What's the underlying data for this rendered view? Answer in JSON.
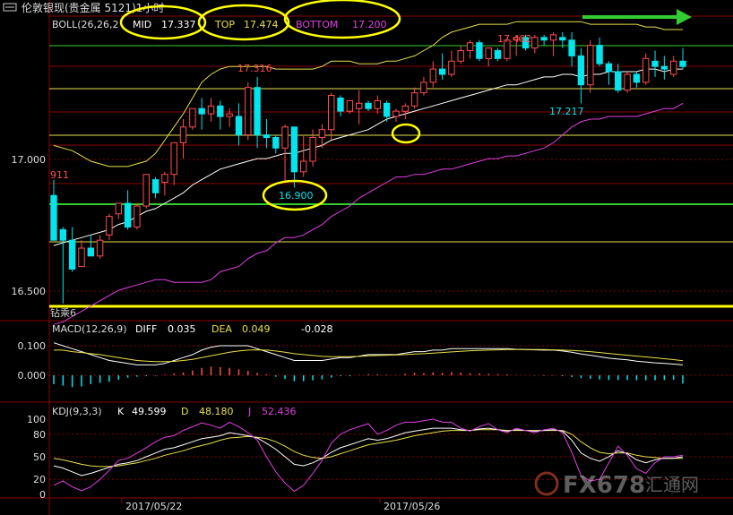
{
  "window": {
    "title": "伦敦银现(贵金属 5121)1小时"
  },
  "colors": {
    "background": "#000000",
    "up_candle": "#ff4d4d",
    "down_candle": "#00e5ee",
    "boll_mid": "#ffffff",
    "boll_top": "#e8e04a",
    "boll_bottom": "#e040e0",
    "macd_diff": "#ffffff",
    "macd_dea": "#e8e04a",
    "kdj_k": "#ffffff",
    "kdj_d": "#e8e04a",
    "kdj_j": "#e040e0",
    "highlight": "#ffff00",
    "grid_red": "#8b0000",
    "line_green": "#33cc33",
    "line_yellow": "#e8e04a"
  },
  "chart_data": [
    {
      "type": "candlestick",
      "indicator": {
        "name": "BOLL(26,26,2)",
        "label_text": "BOLL(26,26,2",
        "mid_label": "MID",
        "mid_value": "17.337",
        "top_label": "TOP",
        "top_value": "17.474",
        "bottom_label": "BOTTOM",
        "bottom_value": "17.200"
      },
      "y_ticks": [
        "17.000",
        "16.500"
      ],
      "ylim": [
        16.42,
        17.62
      ],
      "x_ticks": [
        "2017/05/22",
        "2017/05/26"
      ],
      "annotations": [
        {
          "text": "17.316",
          "kind": "high"
        },
        {
          "text": "911",
          "kind": "high"
        },
        {
          "text": "17.482",
          "kind": "high"
        },
        {
          "text": "16.900",
          "kind": "low"
        },
        {
          "text": "17.217",
          "kind": "low"
        }
      ],
      "watermark_left": "钻乘6",
      "candles": [
        [
          16.87,
          16.93,
          16.7,
          16.7
        ],
        [
          16.74,
          16.75,
          16.46,
          16.7
        ],
        [
          16.7,
          16.75,
          16.58,
          16.59
        ],
        [
          16.6,
          16.7,
          16.6,
          16.67
        ],
        [
          16.67,
          16.72,
          16.64,
          16.64
        ],
        [
          16.64,
          16.72,
          16.63,
          16.7
        ],
        [
          16.72,
          16.8,
          16.7,
          16.79
        ],
        [
          16.8,
          16.84,
          16.78,
          16.84
        ],
        [
          16.84,
          16.89,
          16.74,
          16.75
        ],
        [
          16.75,
          16.84,
          16.74,
          16.83
        ],
        [
          16.83,
          16.95,
          16.82,
          16.95
        ],
        [
          16.93,
          16.94,
          16.86,
          16.88
        ],
        [
          16.92,
          16.96,
          16.87,
          16.95
        ],
        [
          16.95,
          17.07,
          16.91,
          17.07
        ],
        [
          17.07,
          17.16,
          17.01,
          17.13
        ],
        [
          17.13,
          17.2,
          17.12,
          17.2
        ],
        [
          17.2,
          17.24,
          17.12,
          17.18
        ],
        [
          17.18,
          17.24,
          17.15,
          17.21
        ],
        [
          17.21,
          17.23,
          17.12,
          17.17
        ],
        [
          17.17,
          17.2,
          17.13,
          17.18
        ],
        [
          17.17,
          17.22,
          17.06,
          17.1
        ],
        [
          17.1,
          17.3,
          17.08,
          17.28
        ],
        [
          17.28,
          17.32,
          17.05,
          17.1
        ],
        [
          17.1,
          17.16,
          17.05,
          17.09
        ],
        [
          17.09,
          17.1,
          17.03,
          17.05
        ],
        [
          17.05,
          17.14,
          16.92,
          17.13
        ],
        [
          17.13,
          17.13,
          16.9,
          16.96
        ],
        [
          16.96,
          17.1,
          16.94,
          17.0
        ],
        [
          17.0,
          17.12,
          16.98,
          17.09
        ],
        [
          17.09,
          17.14,
          17.05,
          17.12
        ],
        [
          17.12,
          17.26,
          17.08,
          17.25
        ],
        [
          17.24,
          17.25,
          17.17,
          17.19
        ],
        [
          17.19,
          17.23,
          17.18,
          17.23
        ],
        [
          17.2,
          17.27,
          17.14,
          17.22
        ],
        [
          17.22,
          17.23,
          17.19,
          17.2
        ],
        [
          17.2,
          17.25,
          17.18,
          17.23
        ],
        [
          17.22,
          17.23,
          17.15,
          17.17
        ],
        [
          17.17,
          17.2,
          17.15,
          17.19
        ],
        [
          17.19,
          17.22,
          17.16,
          17.21
        ],
        [
          17.21,
          17.28,
          17.2,
          17.26
        ],
        [
          17.26,
          17.32,
          17.25,
          17.3
        ],
        [
          17.3,
          17.38,
          17.28,
          17.35
        ],
        [
          17.35,
          17.41,
          17.31,
          17.33
        ],
        [
          17.33,
          17.42,
          17.32,
          17.38
        ],
        [
          17.38,
          17.44,
          17.37,
          17.42
        ],
        [
          17.42,
          17.46,
          17.39,
          17.45
        ],
        [
          17.45,
          17.46,
          17.38,
          17.39
        ],
        [
          17.39,
          17.43,
          17.36,
          17.43
        ],
        [
          17.42,
          17.43,
          17.38,
          17.39
        ],
        [
          17.39,
          17.47,
          17.38,
          17.46
        ],
        [
          17.46,
          17.48,
          17.4,
          17.47
        ],
        [
          17.47,
          17.48,
          17.42,
          17.43
        ],
        [
          17.43,
          17.48,
          17.41,
          17.47
        ],
        [
          17.47,
          17.48,
          17.44,
          17.46
        ],
        [
          17.46,
          17.49,
          17.4,
          17.48
        ],
        [
          17.47,
          17.49,
          17.43,
          17.46
        ],
        [
          17.46,
          17.49,
          17.36,
          17.4
        ],
        [
          17.4,
          17.43,
          17.22,
          17.29
        ],
        [
          17.29,
          17.46,
          17.26,
          17.44
        ],
        [
          17.44,
          17.47,
          17.36,
          17.37
        ],
        [
          17.37,
          17.38,
          17.29,
          17.34
        ],
        [
          17.34,
          17.37,
          17.26,
          17.27
        ],
        [
          17.27,
          17.34,
          17.26,
          17.33
        ],
        [
          17.33,
          17.34,
          17.28,
          17.3
        ],
        [
          17.3,
          17.41,
          17.29,
          17.39
        ],
        [
          17.38,
          17.42,
          17.32,
          17.36
        ],
        [
          17.36,
          17.4,
          17.31,
          17.35
        ],
        [
          17.33,
          17.4,
          17.32,
          17.38
        ],
        [
          17.38,
          17.43,
          17.35,
          17.36
        ]
      ],
      "boll_mid": [
        16.68,
        16.69,
        16.7,
        16.71,
        16.72,
        16.73,
        16.74,
        16.76,
        16.77,
        16.79,
        16.81,
        16.82,
        16.84,
        16.86,
        16.88,
        16.91,
        16.93,
        16.95,
        16.97,
        16.98,
        16.99,
        17.0,
        17.01,
        17.01,
        17.02,
        17.03,
        17.03,
        17.04,
        17.05,
        17.06,
        17.08,
        17.09,
        17.1,
        17.11,
        17.12,
        17.14,
        17.16,
        17.17,
        17.18,
        17.19,
        17.2,
        17.21,
        17.22,
        17.23,
        17.24,
        17.25,
        17.26,
        17.27,
        17.28,
        17.29,
        17.29,
        17.3,
        17.31,
        17.32,
        17.32,
        17.33,
        17.33,
        17.32,
        17.33,
        17.33,
        17.34,
        17.34,
        17.34,
        17.34,
        17.35,
        17.35,
        17.34,
        17.35,
        17.35
      ],
      "boll_top": [
        17.06,
        17.05,
        17.04,
        17.02,
        17.0,
        16.99,
        16.98,
        16.98,
        16.98,
        16.99,
        17.0,
        17.03,
        17.08,
        17.13,
        17.18,
        17.24,
        17.3,
        17.33,
        17.35,
        17.36,
        17.36,
        17.36,
        17.36,
        17.36,
        17.35,
        17.35,
        17.35,
        17.35,
        17.35,
        17.36,
        17.38,
        17.38,
        17.38,
        17.37,
        17.37,
        17.37,
        17.38,
        17.38,
        17.39,
        17.4,
        17.42,
        17.44,
        17.47,
        17.49,
        17.5,
        17.51,
        17.52,
        17.52,
        17.52,
        17.52,
        17.53,
        17.53,
        17.53,
        17.53,
        17.53,
        17.53,
        17.53,
        17.53,
        17.52,
        17.52,
        17.52,
        17.52,
        17.52,
        17.52,
        17.51,
        17.51,
        17.5,
        17.5,
        17.5
      ],
      "boll_bottom": [
        16.38,
        16.39,
        16.41,
        16.43,
        16.45,
        16.47,
        16.49,
        16.51,
        16.52,
        16.53,
        16.54,
        16.55,
        16.55,
        16.54,
        16.54,
        16.54,
        16.54,
        16.55,
        16.58,
        16.59,
        16.6,
        16.63,
        16.65,
        16.66,
        16.69,
        16.71,
        16.71,
        16.72,
        16.74,
        16.76,
        16.79,
        16.81,
        16.83,
        16.86,
        16.88,
        16.9,
        16.92,
        16.94,
        16.94,
        16.95,
        16.95,
        16.96,
        16.97,
        16.97,
        16.98,
        16.99,
        17.0,
        17.01,
        17.01,
        17.02,
        17.02,
        17.03,
        17.04,
        17.05,
        17.07,
        17.1,
        17.13,
        17.15,
        17.16,
        17.16,
        17.17,
        17.17,
        17.17,
        17.17,
        17.18,
        17.19,
        17.2,
        17.2,
        17.22
      ]
    },
    {
      "type": "macd",
      "indicator": {
        "name": "MACD(12,26,9)",
        "diff_label": "DIFF",
        "diff_value": "0.035",
        "dea_label": "DEA",
        "dea_value": "0.049",
        "macd_value": "-0.028"
      },
      "y_ticks": [
        "0.100",
        "0.000"
      ],
      "ylim": [
        -0.09,
        0.12
      ],
      "diff": [
        0.11,
        0.1,
        0.09,
        0.08,
        0.07,
        0.06,
        0.05,
        0.045,
        0.04,
        0.035,
        0.035,
        0.035,
        0.04,
        0.05,
        0.06,
        0.07,
        0.085,
        0.095,
        0.1,
        0.1,
        0.1,
        0.1,
        0.09,
        0.08,
        0.07,
        0.06,
        0.05,
        0.05,
        0.05,
        0.05,
        0.055,
        0.06,
        0.06,
        0.065,
        0.07,
        0.07,
        0.07,
        0.07,
        0.075,
        0.08,
        0.08,
        0.085,
        0.085,
        0.09,
        0.09,
        0.09,
        0.09,
        0.09,
        0.09,
        0.09,
        0.088,
        0.087,
        0.086,
        0.085,
        0.085,
        0.082,
        0.078,
        0.072,
        0.068,
        0.063,
        0.058,
        0.055,
        0.052,
        0.048,
        0.045,
        0.042,
        0.04,
        0.038,
        0.035
      ],
      "dea": [
        0.085,
        0.085,
        0.08,
        0.077,
        0.073,
        0.07,
        0.065,
        0.06,
        0.055,
        0.05,
        0.048,
        0.046,
        0.046,
        0.047,
        0.05,
        0.054,
        0.06,
        0.066,
        0.072,
        0.078,
        0.082,
        0.085,
        0.086,
        0.085,
        0.082,
        0.078,
        0.073,
        0.07,
        0.067,
        0.064,
        0.063,
        0.063,
        0.063,
        0.064,
        0.066,
        0.067,
        0.068,
        0.069,
        0.07,
        0.072,
        0.073,
        0.075,
        0.077,
        0.079,
        0.081,
        0.083,
        0.084,
        0.085,
        0.086,
        0.087,
        0.087,
        0.087,
        0.087,
        0.087,
        0.086,
        0.085,
        0.084,
        0.082,
        0.08,
        0.077,
        0.074,
        0.071,
        0.068,
        0.065,
        0.062,
        0.059,
        0.056,
        0.053,
        0.049
      ],
      "macd": [
        -0.03,
        -0.035,
        -0.04,
        -0.038,
        -0.03,
        -0.026,
        -0.022,
        -0.015,
        -0.008,
        -0.005,
        -0.003,
        -0.002,
        0.002,
        0.006,
        0.01,
        0.016,
        0.025,
        0.029,
        0.028,
        0.025,
        0.02,
        0.015,
        0.008,
        0.003,
        -0.005,
        -0.012,
        -0.02,
        -0.02,
        -0.017,
        -0.014,
        -0.008,
        -0.003,
        -0.003,
        0.001,
        0.004,
        0.003,
        0.002,
        0.001,
        0.005,
        0.008,
        0.007,
        0.01,
        0.008,
        0.011,
        0.009,
        0.007,
        0.006,
        0.005,
        0.004,
        0.003,
        0.001,
        0.0,
        -0.001,
        -0.002,
        -0.001,
        -0.003,
        -0.006,
        -0.01,
        -0.012,
        -0.014,
        -0.016,
        -0.016,
        -0.016,
        -0.017,
        -0.017,
        -0.017,
        -0.016,
        -0.015,
        -0.028
      ]
    },
    {
      "type": "kdj",
      "indicator": {
        "name": "KDJ(9,3,3)",
        "k_label": "K",
        "k_value": "49.599",
        "d_label": "D",
        "d_value": "48.180",
        "j_label": "J",
        "j_value": "52.436"
      },
      "y_ticks": [
        "100",
        "80",
        "50",
        "20",
        "0"
      ],
      "ylim": [
        0,
        105
      ],
      "k": [
        38,
        35,
        30,
        25,
        28,
        32,
        36,
        40,
        42,
        45,
        50,
        55,
        60,
        62,
        66,
        70,
        74,
        76,
        78,
        82,
        80,
        78,
        75,
        68,
        60,
        50,
        40,
        38,
        42,
        48,
        56,
        62,
        66,
        70,
        74,
        72,
        74,
        78,
        82,
        84,
        86,
        88,
        88,
        88,
        86,
        85,
        87,
        88,
        86,
        84,
        86,
        85,
        84,
        85,
        86,
        84,
        72,
        55,
        48,
        44,
        50,
        58,
        54,
        46,
        42,
        46,
        48,
        48,
        50
      ],
      "d": [
        48,
        46,
        43,
        40,
        38,
        37,
        37,
        38,
        40,
        42,
        45,
        48,
        52,
        55,
        58,
        62,
        65,
        68,
        72,
        75,
        76,
        77,
        76,
        74,
        70,
        64,
        57,
        52,
        49,
        48,
        50,
        54,
        58,
        62,
        66,
        68,
        70,
        72,
        75,
        78,
        80,
        82,
        84,
        85,
        85,
        85,
        86,
        86,
        86,
        85,
        85,
        85,
        85,
        85,
        85,
        85,
        80,
        70,
        62,
        56,
        54,
        55,
        55,
        52,
        50,
        49,
        48,
        48,
        48
      ],
      "j": [
        12,
        18,
        10,
        5,
        10,
        20,
        32,
        45,
        48,
        55,
        62,
        70,
        76,
        78,
        85,
        90,
        95,
        92,
        88,
        96,
        90,
        82,
        72,
        50,
        30,
        15,
        4,
        12,
        28,
        45,
        68,
        80,
        86,
        90,
        94,
        80,
        85,
        92,
        96,
        96,
        98,
        100,
        96,
        96,
        88,
        84,
        90,
        94,
        86,
        82,
        88,
        85,
        82,
        86,
        88,
        82,
        56,
        25,
        18,
        20,
        42,
        64,
        52,
        34,
        28,
        42,
        50,
        50,
        52
      ]
    }
  ],
  "watermark": {
    "brand": "FX678",
    "cn": "汇通网"
  }
}
